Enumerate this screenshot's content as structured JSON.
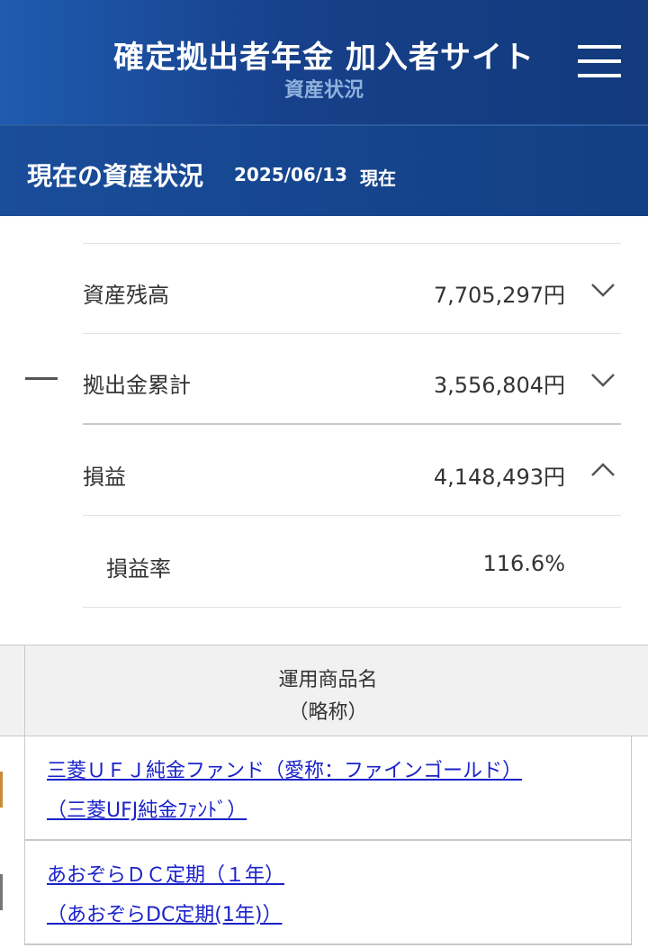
{
  "header": {
    "title": "確定拠出者年金 加入者サイト",
    "subtitle": "資産状況",
    "menu_icon": "hamburger-menu-icon"
  },
  "status": {
    "title": "現在の資産状況",
    "date": "2025/06/13",
    "suffix": "現在"
  },
  "summary": {
    "asset_balance": {
      "label": "資産残高",
      "value": "7,705,297円",
      "state": "collapsed"
    },
    "contributions": {
      "label": "拠出金累計",
      "value": "3,556,804円",
      "state": "collapsed"
    },
    "profit_loss": {
      "label": "損益",
      "value": "4,148,493円",
      "state": "expanded"
    },
    "profit_rate": {
      "label": "損益率",
      "value": "116.6%"
    }
  },
  "table": {
    "header_line1": "運用商品名",
    "header_line2": "（略称）",
    "rows": [
      {
        "name": "三菱ＵＦＪ純金ファンド（愛称：ファインゴールド）",
        "abbr": "（三菱UFJ純金ﾌｧﾝﾄﾞ）",
        "chip_color": "#c98b3a"
      },
      {
        "name": "あおぞらＤＣ定期（１年）",
        "abbr": "（あおぞらDC定期(1年)）",
        "chip_color": "#777777"
      }
    ]
  },
  "colors": {
    "header_bg": "#17408a",
    "link": "#1a22c9"
  }
}
